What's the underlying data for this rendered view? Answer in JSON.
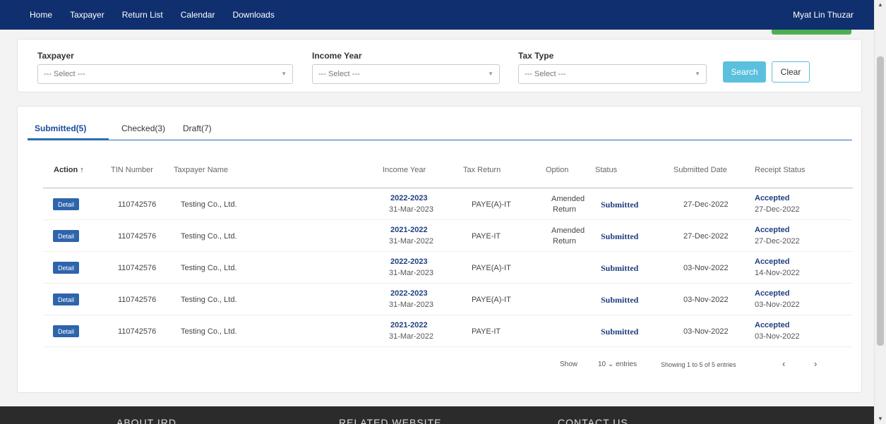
{
  "nav": {
    "links": [
      "Home",
      "Taxpayer",
      "Return List",
      "Calendar",
      "Downloads"
    ],
    "user_name": "Myat Lin Thuzar"
  },
  "filters": {
    "taxpayer": {
      "label": "Taxpayer",
      "value": "--- Select ---"
    },
    "income_year": {
      "label": "Income Year",
      "value": "--- Select ---"
    },
    "tax_type": {
      "label": "Tax Type",
      "value": "--- Select ---"
    },
    "search_label": "Search",
    "clear_label": "Clear"
  },
  "tabs": [
    {
      "label": "Submitted(5)",
      "active": true
    },
    {
      "label": "Checked(3)",
      "active": false
    },
    {
      "label": "Draft(7)",
      "active": false
    }
  ],
  "table": {
    "headers": {
      "action": "Action",
      "tin": "TIN Number",
      "name": "Taxpayer Name",
      "income_year": "Income Year",
      "tax_return": "Tax Return",
      "option": "Option",
      "status": "Status",
      "submitted_date": "Submitted Date",
      "receipt_status": "Receipt Status"
    },
    "detail_label": "Detail",
    "rows": [
      {
        "tin": "110742576",
        "name": "Testing Co., Ltd.",
        "year": "2022-2023",
        "year_date": "31-Mar-2023",
        "tax_return": "PAYE(A)-IT",
        "option_1": "Amended",
        "option_2": "Return",
        "status": "Submitted",
        "submitted": "27-Dec-2022",
        "receipt": "Accepted",
        "receipt_date": "27-Dec-2022"
      },
      {
        "tin": "110742576",
        "name": "Testing Co., Ltd.",
        "year": "2021-2022",
        "year_date": "31-Mar-2022",
        "tax_return": "PAYE-IT",
        "option_1": "Amended",
        "option_2": "Return",
        "status": "Submitted",
        "submitted": "27-Dec-2022",
        "receipt": "Accepted",
        "receipt_date": "27-Dec-2022"
      },
      {
        "tin": "110742576",
        "name": "Testing Co., Ltd.",
        "year": "2022-2023",
        "year_date": "31-Mar-2023",
        "tax_return": "PAYE(A)-IT",
        "option_1": "",
        "option_2": "",
        "status": "Submitted",
        "submitted": "03-Nov-2022",
        "receipt": "Accepted",
        "receipt_date": "14-Nov-2022"
      },
      {
        "tin": "110742576",
        "name": "Testing Co., Ltd.",
        "year": "2022-2023",
        "year_date": "31-Mar-2023",
        "tax_return": "PAYE(A)-IT",
        "option_1": "",
        "option_2": "",
        "status": "Submitted",
        "submitted": "03-Nov-2022",
        "receipt": "Accepted",
        "receipt_date": "03-Nov-2022"
      },
      {
        "tin": "110742576",
        "name": "Testing Co., Ltd.",
        "year": "2021-2022",
        "year_date": "31-Mar-2022",
        "tax_return": "PAYE-IT",
        "option_1": "",
        "option_2": "",
        "status": "Submitted",
        "submitted": "03-Nov-2022",
        "receipt": "Accepted",
        "receipt_date": "03-Nov-2022"
      }
    ]
  },
  "pager": {
    "show_label": "Show",
    "page_size": "10",
    "entries_label": "entries",
    "info": "Showing 1 to 5 of 5 entries"
  },
  "footer": {
    "about": "ABOUT IRD",
    "related": "RELATED WEBSITE",
    "contact": "CONTACT US"
  },
  "icons": {
    "sort": "arrow-up-icon",
    "prev": "chevron-left-icon",
    "next": "chevron-right-icon"
  },
  "colors": {
    "nav_bg": "#0f2f6f",
    "primary": "#2e64ab",
    "info": "#5bc0de",
    "footer_bg": "#2b2b2b"
  }
}
